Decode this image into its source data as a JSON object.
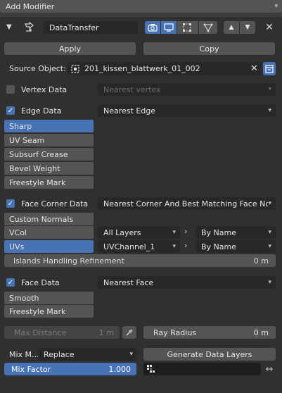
{
  "header": {
    "add_modifier": "Add Modifier"
  },
  "modifier": {
    "name": "DataTransfer",
    "apply": "Apply",
    "copy": "Copy",
    "source_label": "Source Object:",
    "source_value": "201_kissen_blattwerk_01_002"
  },
  "vertex": {
    "label": "Vertex Data",
    "mapping": "Nearest vertex",
    "checked": false
  },
  "edge": {
    "label": "Edge Data",
    "mapping": "Nearest Edge",
    "checked": true,
    "items": [
      "Sharp",
      "UV Seam",
      "Subsurf Crease",
      "Bevel Weight",
      "Freestyle Mark"
    ]
  },
  "face_corner": {
    "label": "Face Corner Data",
    "mapping": "Nearest Corner And Best Matching Face Nor...",
    "checked": true,
    "items": [
      "Custom Normals",
      "VCol",
      "UVs"
    ],
    "vcol_src": "All Layers",
    "vcol_dst": "By Name",
    "uv_src": "UVChannel_1",
    "uv_dst": "By Name",
    "islands_label": "Islands Handling Refinement",
    "islands_value": "0 m"
  },
  "face": {
    "label": "Face Data",
    "mapping": "Nearest Face",
    "checked": true,
    "items": [
      "Smooth",
      "Freestyle Mark"
    ]
  },
  "bottom": {
    "max_distance_label": "Max Distance",
    "max_distance_value": "1 m",
    "ray_radius_label": "Ray Radius",
    "ray_radius_value": "0 m",
    "mix_mode_label": "Mix M...",
    "mix_mode_value": "Replace",
    "generate": "Generate Data Layers",
    "mix_factor_label": "Mix Factor",
    "mix_factor_value": "1.000",
    "mix_factor": 1.0
  },
  "colors": {
    "accent": "#4772b3",
    "bg": "#3d3d3d",
    "field": "#282828",
    "button": "#545454"
  }
}
